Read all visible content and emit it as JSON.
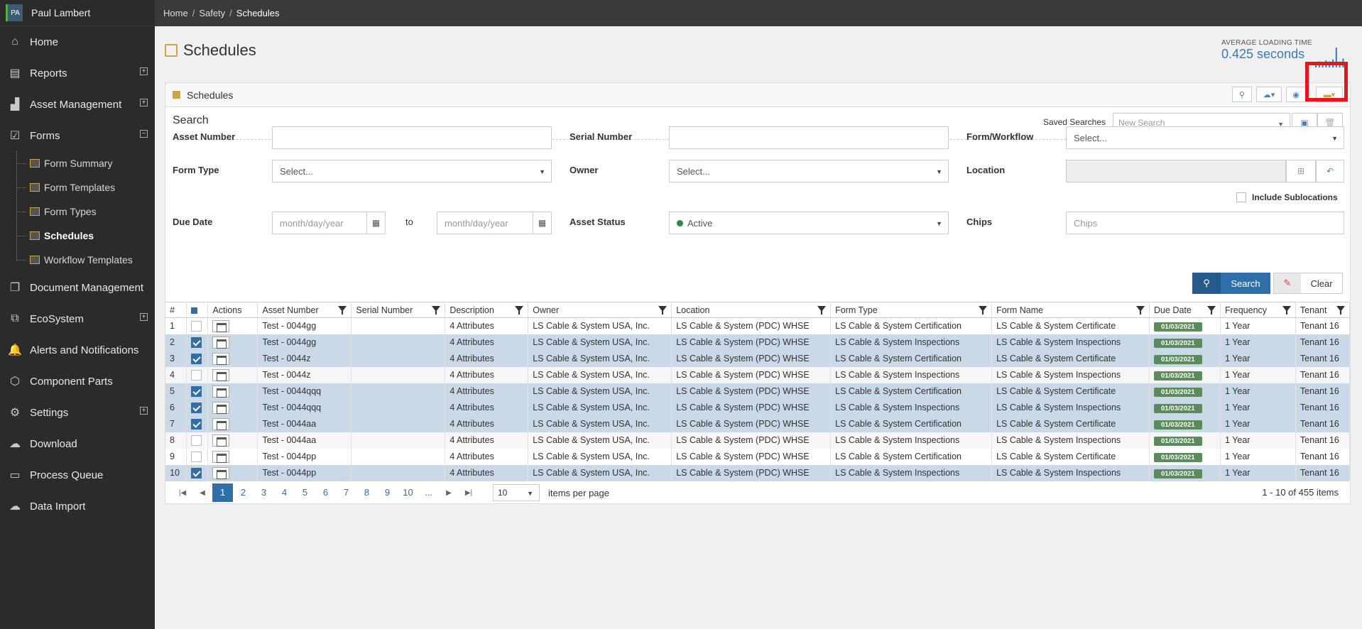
{
  "user": {
    "initials": "PA",
    "name": "Paul Lambert"
  },
  "nav": [
    {
      "label": "Home",
      "icon": "home-icon",
      "glyph": "⌂",
      "expand": ""
    },
    {
      "label": "Reports",
      "icon": "reports-icon",
      "glyph": "▤",
      "expand": "+"
    },
    {
      "label": "Asset Management",
      "icon": "factory-icon",
      "glyph": "▟",
      "expand": "+"
    },
    {
      "label": "Forms",
      "icon": "forms-icon",
      "glyph": "☑",
      "expand": "−"
    }
  ],
  "forms_sub": [
    {
      "label": "Form Summary"
    },
    {
      "label": "Form Templates"
    },
    {
      "label": "Form Types"
    },
    {
      "label": "Schedules"
    },
    {
      "label": "Workflow Templates"
    }
  ],
  "nav2": [
    {
      "label": "Document Management",
      "icon": "document-icon",
      "glyph": "❐",
      "expand": ""
    },
    {
      "label": "EcoSystem",
      "icon": "ecosystem-icon",
      "glyph": "⧉",
      "expand": "+"
    },
    {
      "label": "Alerts and Notifications",
      "icon": "bell-icon",
      "glyph": "🔔",
      "expand": ""
    },
    {
      "label": "Component Parts",
      "icon": "cube-icon",
      "glyph": "⬡",
      "expand": ""
    },
    {
      "label": "Settings",
      "icon": "gear-icon",
      "glyph": "⚙",
      "expand": "+"
    },
    {
      "label": "Download",
      "icon": "download-icon",
      "glyph": "☁",
      "expand": ""
    },
    {
      "label": "Process Queue",
      "icon": "queue-icon",
      "glyph": "▭",
      "expand": ""
    },
    {
      "label": "Data Import",
      "icon": "upload-icon",
      "glyph": "☁",
      "expand": ""
    }
  ],
  "breadcrumb": {
    "home": "Home",
    "safety": "Safety",
    "current": "Schedules",
    "sep": "/"
  },
  "page": {
    "title": "Schedules"
  },
  "loading": {
    "label": "AVERAGE LOADING TIME",
    "value": "0.425 seconds",
    "spark": [
      0.2,
      0.3,
      0.25,
      0.35,
      0.3,
      0.4,
      1.0,
      0.3,
      0.45,
      0.25
    ]
  },
  "panel": {
    "title": "Schedules"
  },
  "search": {
    "heading": "Search",
    "saved_label": "Saved Searches",
    "saved_placeholder": "New Search",
    "asset_number_label": "Asset Number",
    "serial_number_label": "Serial Number",
    "form_workflow_label": "Form/Workflow",
    "form_workflow_value": "Select...",
    "form_type_label": "Form Type",
    "form_type_value": "Select...",
    "owner_label": "Owner",
    "owner_value": "Select...",
    "location_label": "Location",
    "include_sub_label": "Include Sublocations",
    "due_date_label": "Due Date",
    "date_from_placeholder": "month/day/year",
    "to_label": "to",
    "date_to_placeholder": "month/day/year",
    "asset_status_label": "Asset Status",
    "asset_status_value": "Active",
    "chips_label": "Chips",
    "chips_placeholder": "Chips",
    "search_button": "Search",
    "clear_button": "Clear"
  },
  "table": {
    "headers": [
      "#",
      "",
      "Actions",
      "Asset Number",
      "Serial Number",
      "Description",
      "Owner",
      "Location",
      "Form Type",
      "Form Name",
      "Due Date",
      "Frequency",
      "Tenant"
    ],
    "rows": [
      {
        "n": "1",
        "checked": false,
        "asset": "Test - 0044gg",
        "serial": "",
        "desc": "4 Attributes",
        "owner": "LS Cable & System USA, Inc.",
        "location": "LS Cable & System (PDC) WHSE",
        "form_type": "LS Cable & System Certification",
        "form_name": "LS Cable & System Certificate",
        "due": "01/03/2021",
        "freq": "1 Year",
        "tenant": "Tenant 16"
      },
      {
        "n": "2",
        "checked": true,
        "asset": "Test - 0044gg",
        "serial": "",
        "desc": "4 Attributes",
        "owner": "LS Cable & System USA, Inc.",
        "location": "LS Cable & System (PDC) WHSE",
        "form_type": "LS Cable & System Inspections",
        "form_name": "LS Cable & System Inspections",
        "due": "01/03/2021",
        "freq": "1 Year",
        "tenant": "Tenant 16"
      },
      {
        "n": "3",
        "checked": true,
        "asset": "Test - 0044z",
        "serial": "",
        "desc": "4 Attributes",
        "owner": "LS Cable & System USA, Inc.",
        "location": "LS Cable & System (PDC) WHSE",
        "form_type": "LS Cable & System Certification",
        "form_name": "LS Cable & System Certificate",
        "due": "01/03/2021",
        "freq": "1 Year",
        "tenant": "Tenant 16"
      },
      {
        "n": "4",
        "checked": false,
        "asset": "Test - 0044z",
        "serial": "",
        "desc": "4 Attributes",
        "owner": "LS Cable & System USA, Inc.",
        "location": "LS Cable & System (PDC) WHSE",
        "form_type": "LS Cable & System Inspections",
        "form_name": "LS Cable & System Inspections",
        "due": "01/03/2021",
        "freq": "1 Year",
        "tenant": "Tenant 16"
      },
      {
        "n": "5",
        "checked": true,
        "asset": "Test - 0044qqq",
        "serial": "",
        "desc": "4 Attributes",
        "owner": "LS Cable & System USA, Inc.",
        "location": "LS Cable & System (PDC) WHSE",
        "form_type": "LS Cable & System Certification",
        "form_name": "LS Cable & System Certificate",
        "due": "01/03/2021",
        "freq": "1 Year",
        "tenant": "Tenant 16"
      },
      {
        "n": "6",
        "checked": true,
        "asset": "Test - 0044qqq",
        "serial": "",
        "desc": "4 Attributes",
        "owner": "LS Cable & System USA, Inc.",
        "location": "LS Cable & System (PDC) WHSE",
        "form_type": "LS Cable & System Inspections",
        "form_name": "LS Cable & System Inspections",
        "due": "01/03/2021",
        "freq": "1 Year",
        "tenant": "Tenant 16"
      },
      {
        "n": "7",
        "checked": true,
        "asset": "Test - 0044aa",
        "serial": "",
        "desc": "4 Attributes",
        "owner": "LS Cable & System USA, Inc.",
        "location": "LS Cable & System (PDC) WHSE",
        "form_type": "LS Cable & System Certification",
        "form_name": "LS Cable & System Certificate",
        "due": "01/03/2021",
        "freq": "1 Year",
        "tenant": "Tenant 16"
      },
      {
        "n": "8",
        "checked": false,
        "asset": "Test - 0044aa",
        "serial": "",
        "desc": "4 Attributes",
        "owner": "LS Cable & System USA, Inc.",
        "location": "LS Cable & System (PDC) WHSE",
        "form_type": "LS Cable & System Inspections",
        "form_name": "LS Cable & System Inspections",
        "due": "01/03/2021",
        "freq": "1 Year",
        "tenant": "Tenant 16"
      },
      {
        "n": "9",
        "checked": false,
        "asset": "Test - 0044pp",
        "serial": "",
        "desc": "4 Attributes",
        "owner": "LS Cable & System USA, Inc.",
        "location": "LS Cable & System (PDC) WHSE",
        "form_type": "LS Cable & System Certification",
        "form_name": "LS Cable & System Certificate",
        "due": "01/03/2021",
        "freq": "1 Year",
        "tenant": "Tenant 16"
      },
      {
        "n": "10",
        "checked": true,
        "asset": "Test - 0044pp",
        "serial": "",
        "desc": "4 Attributes",
        "owner": "LS Cable & System USA, Inc.",
        "location": "LS Cable & System (PDC) WHSE",
        "form_type": "LS Cable & System Inspections",
        "form_name": "LS Cable & System Inspections",
        "due": "01/03/2021",
        "freq": "1 Year",
        "tenant": "Tenant 16"
      }
    ]
  },
  "pager": {
    "pages": [
      "1",
      "2",
      "3",
      "4",
      "5",
      "6",
      "7",
      "8",
      "9",
      "10",
      "..."
    ],
    "current": "1",
    "page_size": "10",
    "items_label": "items per page",
    "total": "1 - 10 of 455 items"
  },
  "colors": {
    "accent": "#2f6ea8",
    "highlight": "#e8141a",
    "due_badge": "#5b8a5b"
  }
}
